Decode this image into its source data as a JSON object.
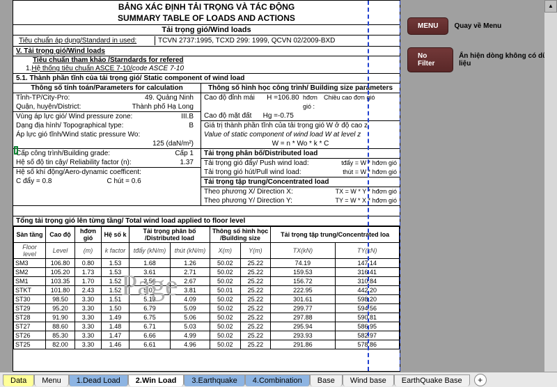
{
  "sidebar": {
    "menu_btn": "MENU",
    "menu_label": "Quay về Menu",
    "filter_btn": "No Filter",
    "filter_label": "Ẩn hiện dòng không có dữ liệu"
  },
  "doc": {
    "title_vn": "BẢNG XÁC ĐỊNH TẢI TRỌNG VÀ TÁC ĐỘNG",
    "title_en": "SUMMARY TABLE OF LOADS AND ACTIONS",
    "windloads": "Tải trọng gió/Wind loads",
    "std_label": "Tiêu chuẩn áp dụng/Standard in used:",
    "std_value": "TCVN 2737:1995, TCXD 299: 1999, QCVN 02/2009-BXD",
    "sec_v": "V.   Tải trọng gió/Wind loads",
    "sec_ref": "Tiêu chuẩn tham khảo /Starndards for refered",
    "ref1_a": "Hệ thống tiêu chuẩn  ASCE 7-10/ ",
    "ref1_b": "code ASCE 7-10",
    "sec_51": "5.1.   Thành phần tĩnh của tải trọng gió/ Static component of wind load",
    "param_hdr_l": "Thông số tính toán/Parameters for calculation",
    "param_hdr_r": "Thông số hình học công trình/ Building size parameters",
    "p_city_l": "Tỉnh-TP/City-Pro:",
    "p_city_v": "49. Quảng Ninh",
    "p_dist_l": "Quận, huyện/District:",
    "p_dist_v": "Thành phố Hạ Long",
    "p_pzone_l": "Vùng áp lực gió/ Wind pressure zone:",
    "p_pzone_v": "III.B",
    "p_topo_l": "Dạng địa hình/ Topographical type:",
    "p_topo_v": "B",
    "p_wsp_l": "Áp lực gió tĩnh/Wind static pressure Wo:",
    "p_wsp_v": "125  (daN/m²)",
    "p_grade_l": "Cấp công trình/Building grade:",
    "p_grade_v": "Cấp 1",
    "p_rel_l": "Hệ số độ tin cậy/ Reliability factor (n):",
    "p_rel_v": "1.37",
    "p_aero_l": "Hệ số khí động/Aero-dynamic coefficent:",
    "p_c1": "C đẩy =    0.8",
    "p_c2": "C hút  =    0.6",
    "r_roof": "Cao độ đỉnh mái",
    "r_roof_h": "H = ",
    "r_roof_v": "106.80",
    "r_hdon": "hđơn gió :",
    "r_hdon_lbl": "Chiều cao đơn gió",
    "r_ground": "Cao độ mặt đất",
    "r_ground_h": "Hg = ",
    "r_ground_v": "-0.75",
    "r_valhdr_vn": "Giá trị thành phần tĩnh của tải trọng gió W ở độ cao z",
    "r_valhdr_en": "Value of static component of wind load W at level z",
    "r_formula": "W = n * Wo * k * C",
    "r_dist_hdr": "Tải trọng phân bố/Distributed load",
    "r_push": "Tải trọng gió đẩy/ Push wind load:",
    "r_push_f": "tđẩy  = W * hđơn gió",
    "r_pull": "Tải trọng gió hút/Pull wind load:",
    "r_pull_f": "thút   = W * hđơn gió",
    "r_conc_hdr": "Tải trọng tập trung/Concentrated load",
    "r_dirx": "Theo phương X/ Direction X:",
    "r_dirx_f": "TX  = W * Y * hđơn gió",
    "r_diry": "Theo phương Y/ Direction Y:",
    "r_diry_f": "TY  = W * X * hđơn gió",
    "total_hdr": "Tổng tải trọng gió lên từng tầng/ Total wind load applied to floor level"
  },
  "table": {
    "h1": "Sàn tầng",
    "h2": "Cao độ",
    "h3": "hđơn gió",
    "h4": "Hệ số k",
    "h5": "Tải trọng phân bố\n/Distributed load",
    "h6": "Thông số hình học\n/Building size",
    "h7": "Tải trọng tập trung/Concentrated loa",
    "sh1": "Floor level",
    "sh2": "Level",
    "sh3": "(m)",
    "sh4": "k factor",
    "sh5a": "tđẩy (kN/m)",
    "sh5b": "thút (kN/m)",
    "sh6a": "X(m)",
    "sh6b": "Y(m)",
    "sh7a": "TX(kN)",
    "sh7b": "TY(kN)",
    "rows": [
      {
        "c": [
          "SM3",
          "106.80",
          "0.80",
          "1.53",
          "1.68",
          "1.26",
          "50.02",
          "25.22",
          "74.19",
          "147.14"
        ]
      },
      {
        "c": [
          "SM2",
          "105.20",
          "1.73",
          "1.53",
          "3.61",
          "2.71",
          "50.02",
          "25.22",
          "159.53",
          "316.41"
        ]
      },
      {
        "c": [
          "SM1",
          "103.35",
          "1.70",
          "1.52",
          "3.56",
          "2.67",
          "50.02",
          "25.22",
          "156.72",
          "310.84"
        ]
      },
      {
        "c": [
          "STKT",
          "101.80",
          "2.43",
          "1.52",
          "5.07",
          "3.81",
          "50.01",
          "25.22",
          "222.95",
          "442.20"
        ]
      },
      {
        "c": [
          "ST30",
          "98.50",
          "3.30",
          "1.51",
          "5.13",
          "4.09",
          "50.02",
          "25.22",
          "301.61",
          "598.20"
        ]
      },
      {
        "c": [
          "ST29",
          "95.20",
          "3.30",
          "1.50",
          "6.79",
          "5.09",
          "50.02",
          "25.22",
          "299.77",
          "594.56"
        ]
      },
      {
        "c": [
          "ST28",
          "91.90",
          "3.30",
          "1.49",
          "6.75",
          "5.06",
          "50.02",
          "25.22",
          "297.88",
          "590.81"
        ]
      },
      {
        "c": [
          "ST27",
          "88.60",
          "3.30",
          "1.48",
          "6.71",
          "5.03",
          "50.02",
          "25.22",
          "295.94",
          "586.95"
        ]
      },
      {
        "c": [
          "ST26",
          "85.30",
          "3.30",
          "1.47",
          "6.66",
          "4.99",
          "50.02",
          "25.22",
          "293.93",
          "582.97"
        ]
      },
      {
        "c": [
          "ST25",
          "82.00",
          "3.30",
          "1.46",
          "6.61",
          "4.96",
          "50.02",
          "25.22",
          "291.86",
          "578.86"
        ]
      }
    ]
  },
  "tabs": {
    "t1": "Data",
    "t2": "Menu",
    "t3": "1.Dead Load",
    "t4": "2.Win Load",
    "t5": "3.Earthquake",
    "t6": "4.Combination",
    "t7": "Base",
    "t8": "Wind base",
    "t9": "EarthQuake Base",
    "add": "+"
  }
}
